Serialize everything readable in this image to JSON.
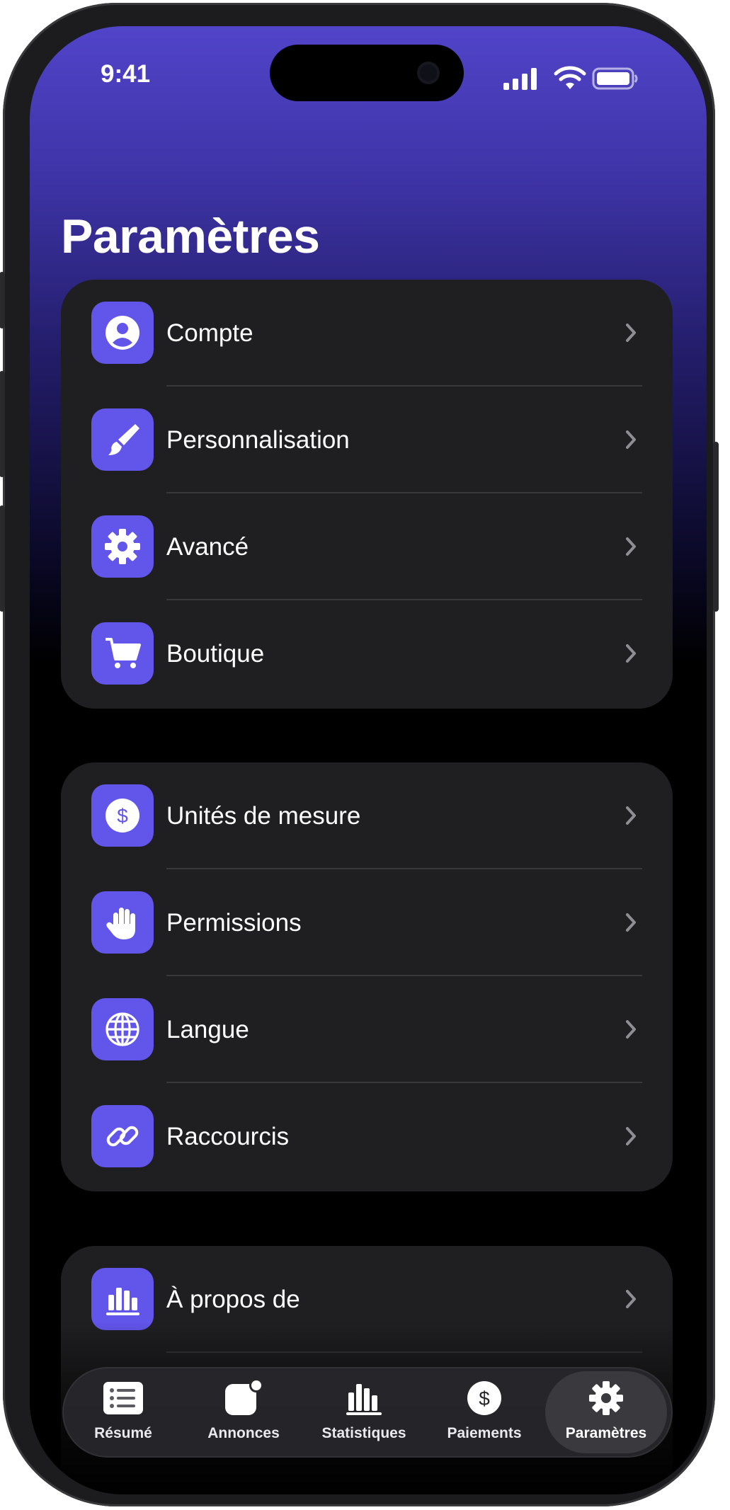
{
  "status_bar": {
    "time": "9:41"
  },
  "page": {
    "title": "Paramètres"
  },
  "groups": [
    {
      "items": [
        {
          "label": "Compte",
          "icon": "person-circle-icon"
        },
        {
          "label": "Personnalisation",
          "icon": "paintbrush-icon"
        },
        {
          "label": "Avancé",
          "icon": "gear-icon"
        },
        {
          "label": "Boutique",
          "icon": "cart-icon"
        }
      ]
    },
    {
      "items": [
        {
          "label": "Unités de mesure",
          "icon": "dollar-circle-icon"
        },
        {
          "label": "Permissions",
          "icon": "hand-icon"
        },
        {
          "label": "Langue",
          "icon": "globe-icon"
        },
        {
          "label": "Raccourcis",
          "icon": "link-icon"
        }
      ]
    },
    {
      "items": [
        {
          "label": "À propos de",
          "icon": "chart-bars-icon"
        }
      ]
    }
  ],
  "tab_bar": {
    "tabs": [
      {
        "label": "Résumé",
        "icon": "list-icon",
        "active": false
      },
      {
        "label": "Annonces",
        "icon": "notification-badge-icon",
        "active": false
      },
      {
        "label": "Statistiques",
        "icon": "chart-bars-icon",
        "active": false
      },
      {
        "label": "Paiements",
        "icon": "dollar-circle-icon",
        "active": false
      },
      {
        "label": "Paramètres",
        "icon": "gear-icon",
        "active": true
      }
    ]
  },
  "colors": {
    "accent": "#6255EA",
    "header_gradient_top": "#5144C9",
    "card_background": "#1F1F21",
    "background": "#000000"
  }
}
